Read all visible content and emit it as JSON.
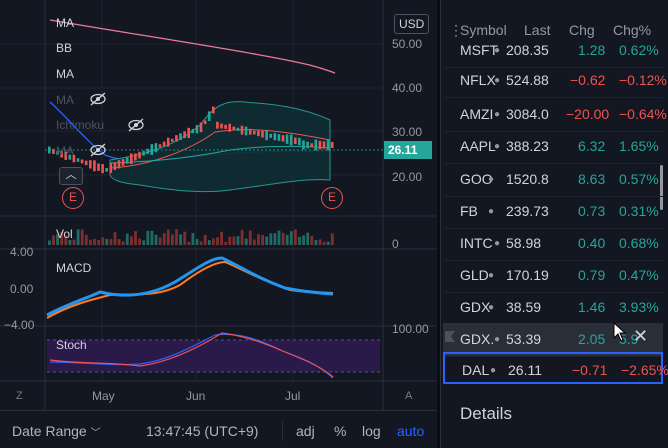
{
  "chart": {
    "currency": "USD",
    "price_axis": [
      "50.00",
      "40.00",
      "30.00",
      "20.00",
      "0"
    ],
    "current_price": "26.11",
    "indicators": [
      "MA",
      "BB",
      "MA",
      "MA",
      "Ichimoku",
      "MA"
    ],
    "volume_label": "Vol",
    "macd_label": "MACD",
    "macd_axis": [
      "4.00",
      "0.00",
      "−4.00"
    ],
    "stoch_label": "Stoch",
    "stoch_axis": [
      "100.00"
    ],
    "earnings_marker": "E",
    "time_axis": [
      "May",
      "Jun",
      "Jul"
    ],
    "left_scale": "Z",
    "auto_scale": "A"
  },
  "bottom_bar": {
    "date_range": "Date Range",
    "time": "13:47:45 (UTC+9)",
    "adj": "adj",
    "percent": "%",
    "log": "log",
    "auto": "auto"
  },
  "watchlist": {
    "headers": {
      "symbol": "Symbol",
      "last": "Last",
      "chg": "Chg",
      "chgp": "Chg%"
    },
    "rows": [
      {
        "symbol": "MSFT",
        "last": "208.35",
        "chg": "1.28",
        "chgp": "0.62%",
        "dir": "up"
      },
      {
        "symbol": "NFLX",
        "last": "524.88",
        "chg": "−0.62",
        "chgp": "−0.12%",
        "dir": "down"
      },
      {
        "symbol": "AMZI",
        "last": "3084.0",
        "chg": "−20.00",
        "chgp": "−0.64%",
        "dir": "down"
      },
      {
        "symbol": "AAPL",
        "last": "388.23",
        "chg": "6.32",
        "chgp": "1.65%",
        "dir": "up"
      },
      {
        "symbol": "GOO",
        "last": "1520.8",
        "chg": "8.63",
        "chgp": "0.57%",
        "dir": "up"
      },
      {
        "symbol": "FB",
        "last": "239.73",
        "chg": "0.73",
        "chgp": "0.31%",
        "dir": "up"
      },
      {
        "symbol": "INTC",
        "last": "58.98",
        "chg": "0.40",
        "chgp": "0.68%",
        "dir": "up"
      },
      {
        "symbol": "GLD",
        "last": "170.19",
        "chg": "0.79",
        "chgp": "0.47%",
        "dir": "up"
      },
      {
        "symbol": "GDX",
        "last": "38.59",
        "chg": "1.46",
        "chgp": "3.93%",
        "dir": "up"
      },
      {
        "symbol": "GDX.",
        "last": "53.39",
        "chg": "2.05",
        "chgp": "5.9",
        "dir": "up"
      },
      {
        "symbol": "DAL",
        "last": "26.11",
        "chg": "−0.71",
        "chgp": "−2.65%",
        "dir": "down"
      }
    ],
    "details_label": "Details"
  }
}
